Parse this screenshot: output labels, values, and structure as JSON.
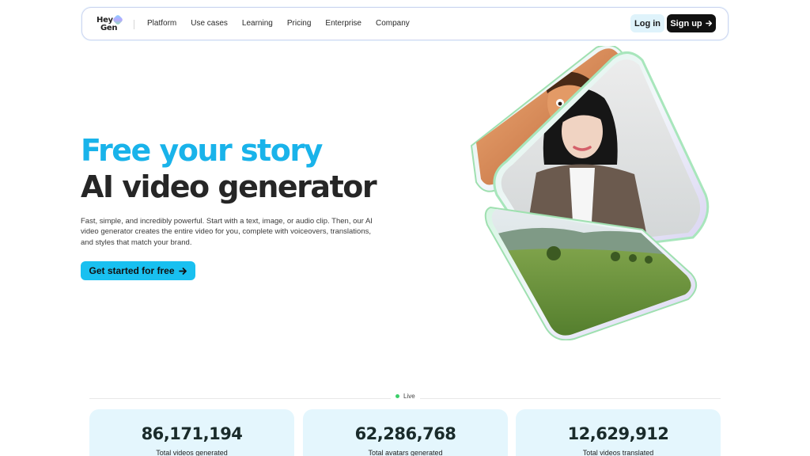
{
  "brand": {
    "line1": "Hey",
    "line2": "Gen"
  },
  "nav": {
    "items": [
      "Platform",
      "Use cases",
      "Learning",
      "Pricing",
      "Enterprise",
      "Company"
    ],
    "login_label": "Log in",
    "signup_label": "Sign up",
    "signup_icon": "arrow-right-icon"
  },
  "hero": {
    "headline_accent": "Free your story",
    "headline_main": "AI video generator",
    "description": "Fast, simple, and incredibly powerful. Start with a text, image, or audio clip. Then, our AI video generator creates the entire video for you, complete with voiceovers, translations, and styles that match your brand.",
    "cta_label": "Get started for free",
    "cta_icon": "arrow-right-icon"
  },
  "stats": {
    "live_label": "Live",
    "cards": [
      {
        "value": "86,171,194",
        "label": "Total videos generated"
      },
      {
        "value": "62,286,768",
        "label": "Total avatars generated"
      },
      {
        "value": "12,629,912",
        "label": "Total videos translated"
      }
    ]
  },
  "colors": {
    "accent": "#19b3ea",
    "cta": "#19c0f0",
    "stat_card": "#e4f6fd",
    "live_dot": "#3ccf6a"
  }
}
